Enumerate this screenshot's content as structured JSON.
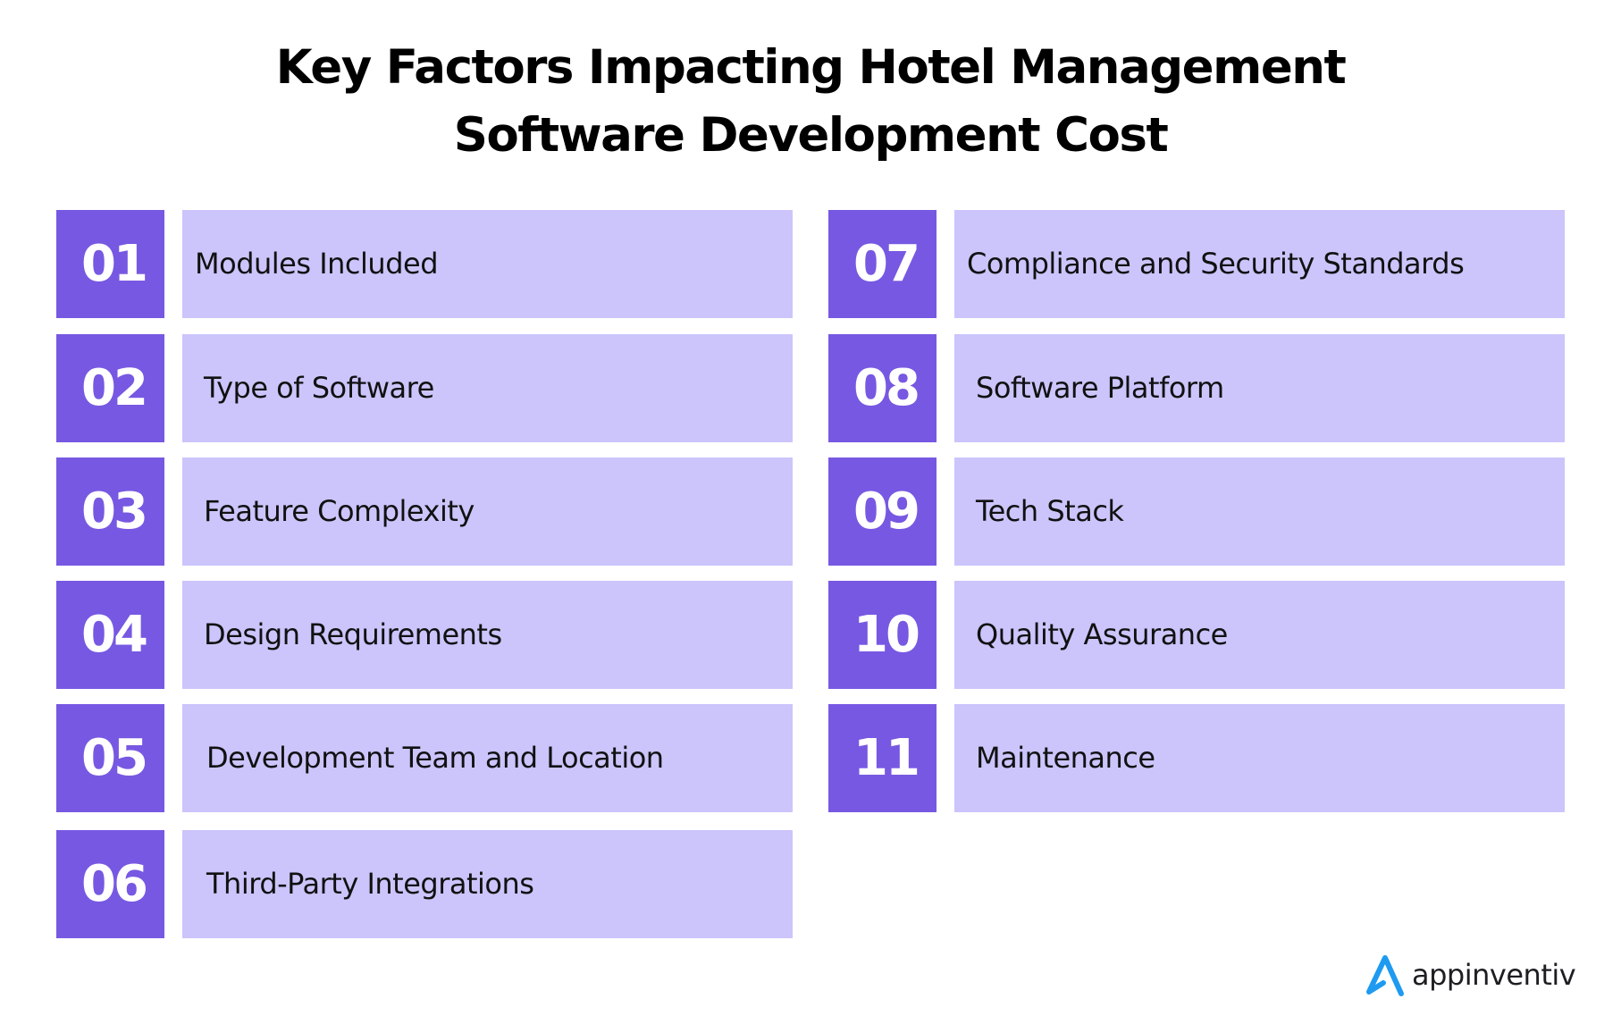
{
  "title": {
    "line1": "Key Factors Impacting Hotel Management",
    "line2": "Software Development Cost"
  },
  "colors": {
    "number_box": "#7758e2",
    "label_box": "#cbc5fc",
    "logo_accent": "#1e9bf0"
  },
  "factors": [
    {
      "number": "01",
      "label": "Modules Included"
    },
    {
      "number": "02",
      "label": "Type of Software"
    },
    {
      "number": "03",
      "label": "Feature Complexity"
    },
    {
      "number": "04",
      "label": "Design Requirements"
    },
    {
      "number": "05",
      "label": "Development Team and Location"
    },
    {
      "number": "06",
      "label": "Third-Party Integrations"
    },
    {
      "number": "07",
      "label": "Compliance and Security Standards"
    },
    {
      "number": "08",
      "label": "Software Platform"
    },
    {
      "number": "09",
      "label": "Tech Stack"
    },
    {
      "number": "10",
      "label": "Quality Assurance"
    },
    {
      "number": "11",
      "label": "Maintenance"
    }
  ],
  "logo": {
    "icon": "appinventiv-a-icon",
    "text": "appinventiv"
  }
}
